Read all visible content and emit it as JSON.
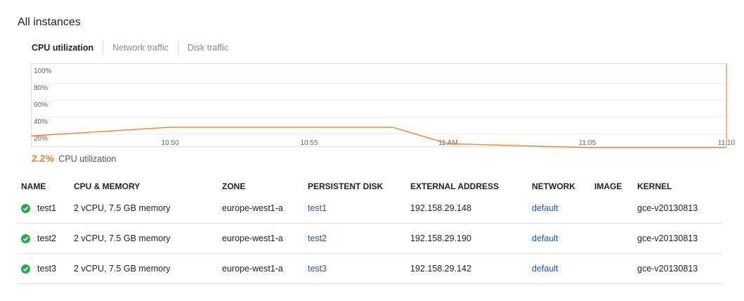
{
  "page": {
    "title": "All instances"
  },
  "tabs": [
    {
      "label": "CPU utilization",
      "active": true
    },
    {
      "label": "Network traffic",
      "active": false
    },
    {
      "label": "Disk traffic",
      "active": false
    }
  ],
  "chart_data": {
    "type": "line",
    "y_unit": "%",
    "ylim": [
      20,
      100
    ],
    "y_ticks": [
      "100%",
      "80%",
      "60%",
      "40%",
      "20%"
    ],
    "x_ticks": [
      "10:50",
      "10:55",
      "11 AM",
      "11:05",
      "11:10"
    ],
    "x": [
      "10:45",
      "10:50",
      "10:54",
      "10:58",
      "11:00",
      "11:05",
      "11:08",
      "11:10"
    ],
    "series": [
      {
        "values": [
          22,
          31,
          31,
          31,
          14,
          10,
          10,
          10
        ]
      }
    ],
    "line_color": "#f0822c",
    "grid": true
  },
  "summary": {
    "value": "2.2%",
    "label": "CPU utilization"
  },
  "table": {
    "headers": [
      "NAME",
      "CPU & MEMORY",
      "ZONE",
      "PERSISTENT DISK",
      "EXTERNAL ADDRESS",
      "NETWORK",
      "IMAGE",
      "KERNEL"
    ],
    "rows": [
      {
        "status": "running",
        "name": "test1",
        "cpu_memory": "2 vCPU, 7.5 GB memory",
        "zone": "europe-west1-a",
        "disk": "test1",
        "address": "192.158.29.148",
        "network": "default",
        "image": "",
        "kernel": "gce-v20130813"
      },
      {
        "status": "running",
        "name": "test2",
        "cpu_memory": "2 vCPU, 7.5 GB memory",
        "zone": "europe-west1-a",
        "disk": "test2",
        "address": "192.158.29.190",
        "network": "default",
        "image": "",
        "kernel": "gce-v20130813"
      },
      {
        "status": "running",
        "name": "test3",
        "cpu_memory": "2 vCPU, 7.5 GB memory",
        "zone": "europe-west1-a",
        "disk": "test3",
        "address": "192.158.29.142",
        "network": "default",
        "image": "",
        "kernel": "gce-v20130813"
      }
    ]
  },
  "icons": {
    "status_running": "check-circle-icon"
  },
  "colors": {
    "accent": "#f0822c",
    "link": "#1a55c4",
    "status_ok": "#2ca94f"
  }
}
